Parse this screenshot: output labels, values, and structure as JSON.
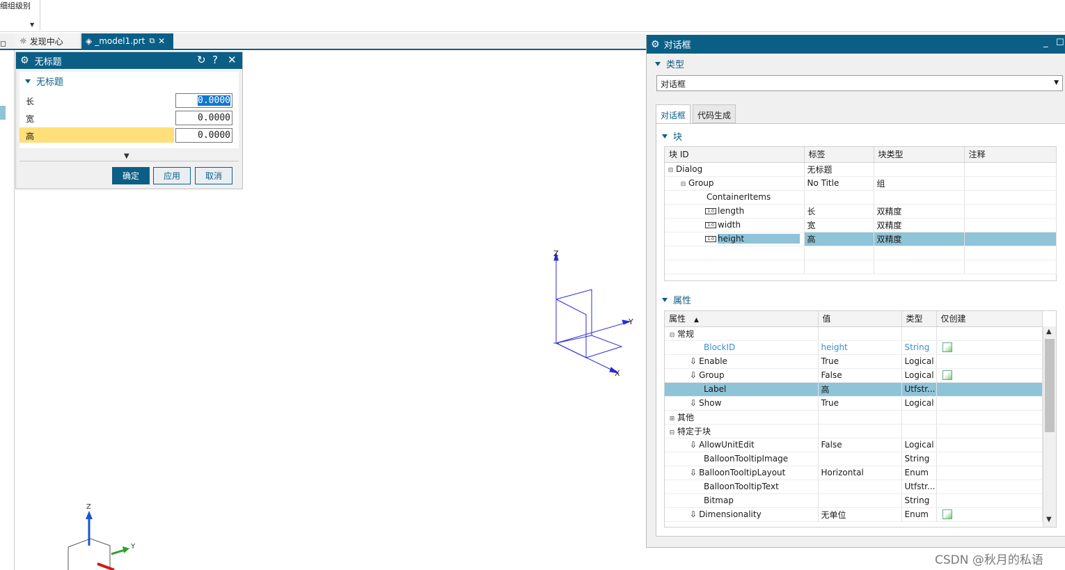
{
  "ribbon": {
    "group_label": "细组级别"
  },
  "tabs": [
    {
      "label": "发现中心"
    },
    {
      "label": "_model1.prt"
    }
  ],
  "small_dialog": {
    "title": "无标题",
    "group_title": "无标题",
    "fields": [
      {
        "label": "长",
        "value": "0.0000"
      },
      {
        "label": "宽",
        "value": "0.0000"
      },
      {
        "label": "高",
        "value": "0.0000"
      }
    ],
    "buttons": {
      "ok": "确定",
      "apply": "应用",
      "cancel": "取消"
    }
  },
  "triad": {
    "x": "X",
    "y": "Y",
    "z": "Z"
  },
  "panel": {
    "title": "对话框",
    "type_section": "类型",
    "type_value": "对话框",
    "tabs": [
      "对话框",
      "代码生成"
    ],
    "blocks_section": "块",
    "blocks_headers": [
      "块 ID",
      "标签",
      "块类型",
      "注释"
    ],
    "blocks_rows": [
      {
        "id": "Dialog",
        "label": "无标题",
        "type": "",
        "note": ""
      },
      {
        "id": "Group",
        "label": "No Title",
        "type": "组",
        "note": ""
      },
      {
        "id": "ContainerItems",
        "label": "",
        "type": "",
        "note": ""
      },
      {
        "id": "length",
        "label": "长",
        "type": "双精度",
        "note": ""
      },
      {
        "id": "width",
        "label": "宽",
        "type": "双精度",
        "note": ""
      },
      {
        "id": "height",
        "label": "高",
        "type": "双精度",
        "note": ""
      }
    ],
    "props_section": "属性",
    "props_headers": [
      "属性",
      "值",
      "类型",
      "仅创建"
    ],
    "props_rows": [
      {
        "name": "常规",
        "value": "",
        "type": ""
      },
      {
        "name": "BlockID",
        "value": "height",
        "type": "String"
      },
      {
        "name": "Enable",
        "value": "True",
        "type": "Logical"
      },
      {
        "name": "Group",
        "value": "False",
        "type": "Logical"
      },
      {
        "name": "Label",
        "value": "高",
        "type": "Utfstr..."
      },
      {
        "name": "Show",
        "value": "True",
        "type": "Logical"
      },
      {
        "name": "其他",
        "value": "",
        "type": ""
      },
      {
        "name": "特定于块",
        "value": "",
        "type": ""
      },
      {
        "name": "AllowUnitEdit",
        "value": "False",
        "type": "Logical"
      },
      {
        "name": "BalloonTooltipImage",
        "value": "",
        "type": "String"
      },
      {
        "name": "BalloonTooltipLayout",
        "value": "Horizontal",
        "type": "Enum"
      },
      {
        "name": "BalloonTooltipText",
        "value": "",
        "type": "Utfstr..."
      },
      {
        "name": "Bitmap",
        "value": "",
        "type": "String"
      },
      {
        "name": "Dimensionality",
        "value": "无单位",
        "type": "Enum"
      }
    ]
  },
  "watermark": "CSDN @秋月的私语"
}
